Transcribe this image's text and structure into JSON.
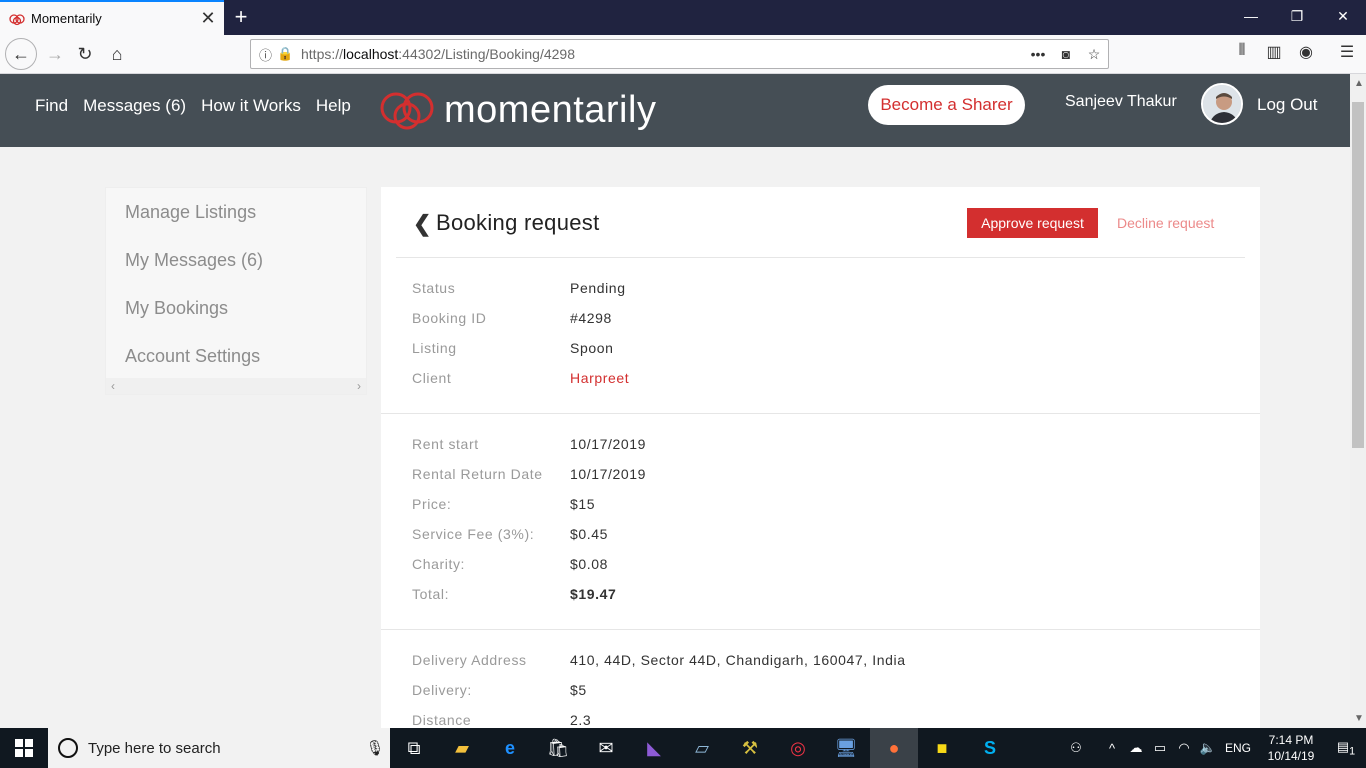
{
  "browser": {
    "tab_title": "Momentarily",
    "url_prefix": "https://",
    "url_host": "localhost",
    "url_rest": ":44302/Listing/Booking/4298",
    "icons": [
      "back-icon",
      "forward-icon",
      "reload-icon",
      "home-icon",
      "info-icon",
      "lock-icon",
      "more-icon",
      "pocket-icon",
      "star-icon",
      "library-icon",
      "sidebar-icon",
      "account-icon",
      "menu-icon"
    ]
  },
  "header": {
    "nav": [
      "Find",
      "Messages (6)",
      "How it Works",
      "Help"
    ],
    "logo_text": "momentarily",
    "become_sharer": "Become a Sharer",
    "username": "Sanjeev Thakur",
    "logout": "Log Out",
    "brand_color": "#d32f2f",
    "header_bg": "#454e55"
  },
  "sidebar": {
    "items": [
      {
        "label": "Manage Listings"
      },
      {
        "label": "My Messages (6)"
      },
      {
        "label": "My Bookings"
      },
      {
        "label": "Account Settings"
      }
    ]
  },
  "booking": {
    "title": "Booking request",
    "approve": "Approve request",
    "decline": "Decline request",
    "section1": [
      {
        "k": "Status",
        "v": "Pending"
      },
      {
        "k": "Booking ID",
        "v": "#4298"
      },
      {
        "k": "Listing",
        "v": "Spoon"
      },
      {
        "k": "Client",
        "v": "Harpreet"
      }
    ],
    "section2": [
      {
        "k": "Rent start",
        "v": "10/17/2019"
      },
      {
        "k": "Rental Return Date",
        "v": "10/17/2019"
      },
      {
        "k": "Price:",
        "v": "$15"
      },
      {
        "k": "Service Fee (3%):",
        "v": "$0.45"
      },
      {
        "k": "Charity:",
        "v": "$0.08"
      },
      {
        "k": "Total:",
        "v": "$19.47"
      }
    ],
    "section3": [
      {
        "k": "Delivery Address",
        "v": "410, 44D, Sector 44D, Chandigarh, 160047, India"
      },
      {
        "k": "Delivery:",
        "v": "$5"
      },
      {
        "k": "Distance",
        "v": "2.3"
      }
    ]
  },
  "taskbar": {
    "search_placeholder": "Type here to search",
    "lang": "ENG",
    "time": "7:14 PM",
    "date": "10/14/19",
    "notif_count": "1"
  }
}
